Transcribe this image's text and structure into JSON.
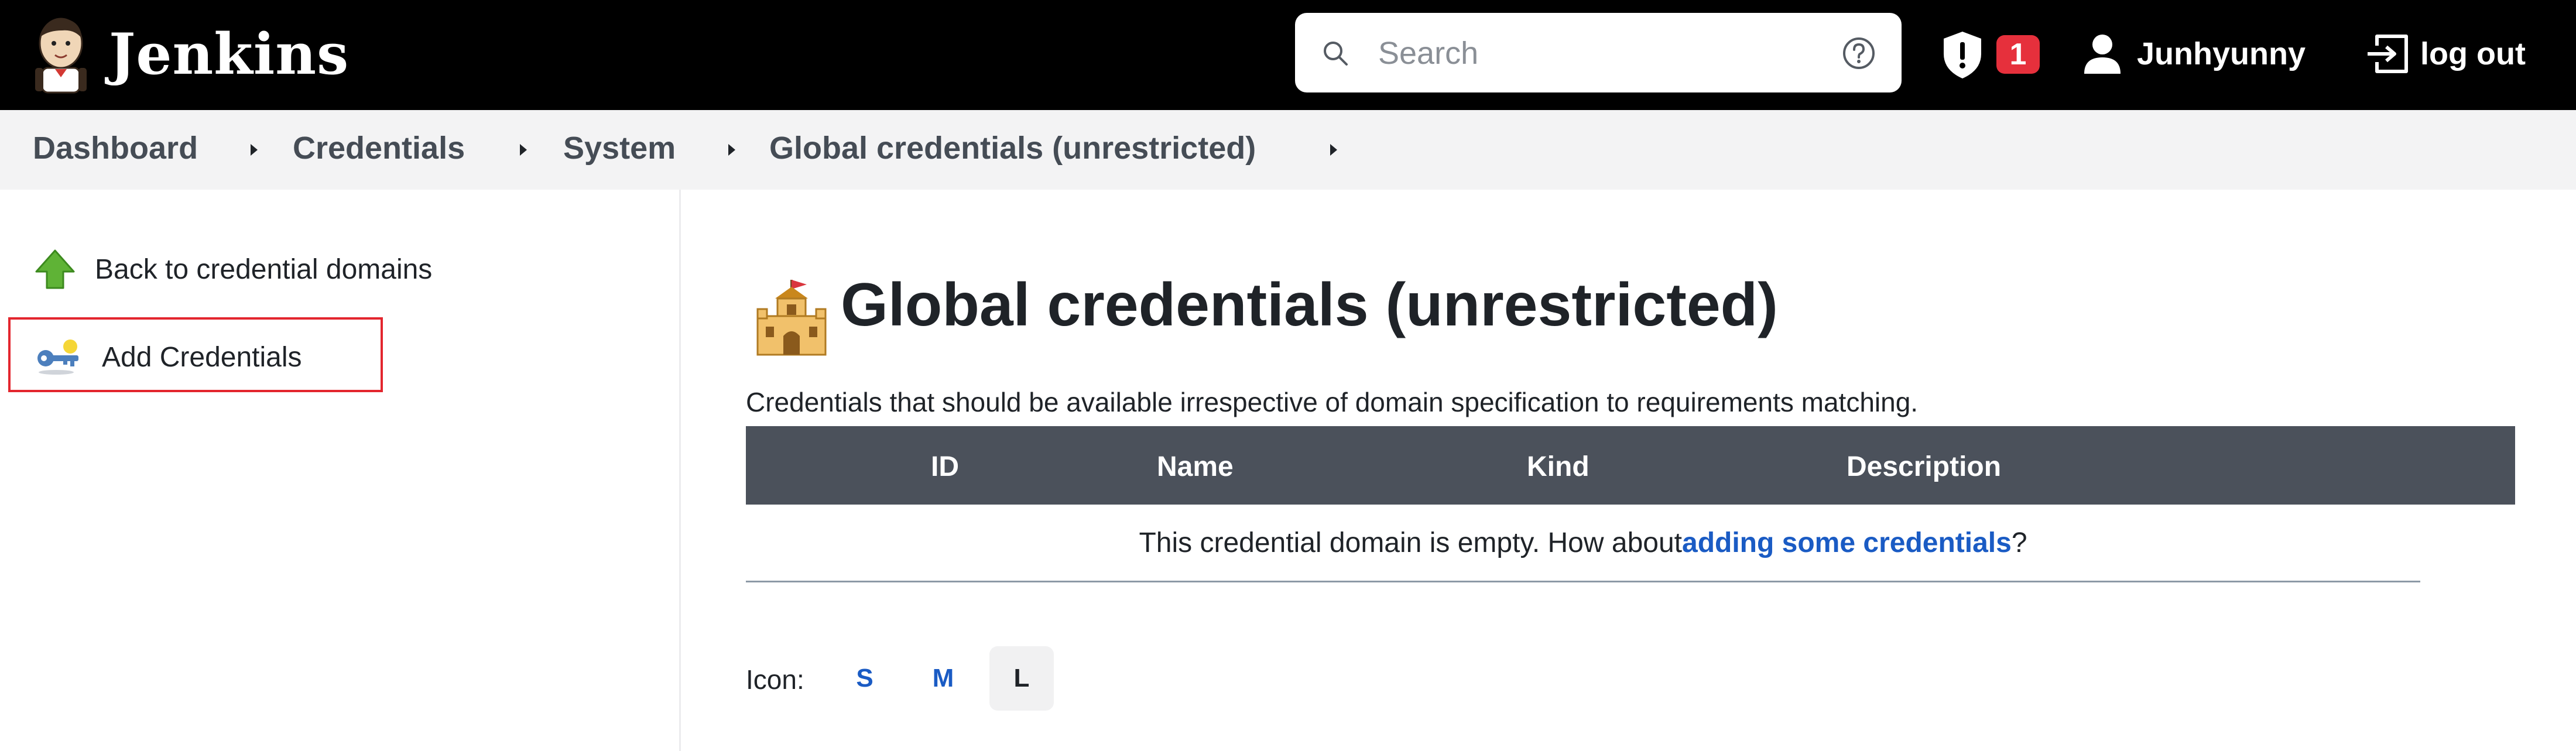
{
  "header": {
    "title": "Jenkins",
    "search_placeholder": "Search",
    "security_badge_count": "1",
    "username": "Junhyunny",
    "logout_label": "log out",
    "colors": {
      "bar": "#000000",
      "badge": "#e6303c"
    }
  },
  "breadcrumb": {
    "items": [
      "Dashboard",
      "Credentials",
      "System",
      "Global credentials (unrestricted)"
    ]
  },
  "sidebar": {
    "items": [
      {
        "label": "Back to credential domains",
        "icon": "green-up-arrow-icon"
      },
      {
        "label": "Add Credentials",
        "icon": "key-icon"
      }
    ],
    "highlight_color": "#e3262e"
  },
  "main": {
    "title": "Global credentials (unrestricted)",
    "title_icon": "castle-icon",
    "description": "Credentials that should be available irrespective of domain specification to requirements matching.",
    "table": {
      "columns": [
        "ID",
        "Name",
        "Kind",
        "Description"
      ],
      "empty_text": "This credential domain is empty. How about ",
      "empty_link": "adding some credentials",
      "empty_suffix": "?"
    },
    "icon_size": {
      "label": "Icon:",
      "options": [
        "S",
        "M",
        "L"
      ],
      "selected": "L"
    },
    "colors": {
      "link": "#1a5bc4",
      "table_header": "#4b515b"
    }
  }
}
